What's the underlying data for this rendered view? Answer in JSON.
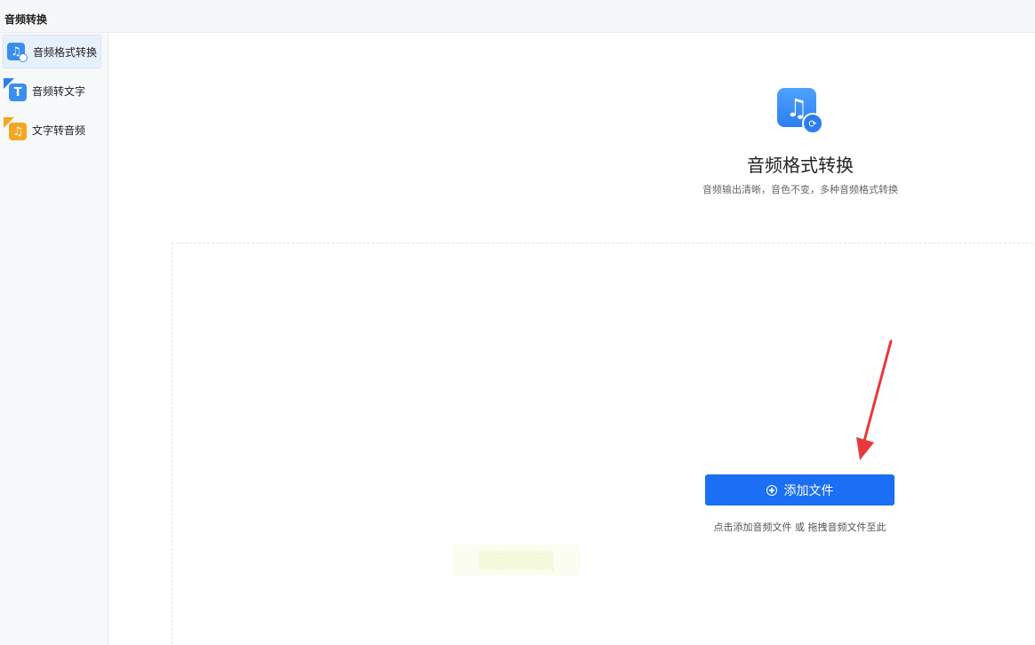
{
  "window": {
    "title": "音频转换"
  },
  "sidebar": {
    "items": [
      {
        "label": "音频格式转换",
        "icon": "audio-convert-icon",
        "active": true
      },
      {
        "label": "音频转文字",
        "icon": "audio-to-text-icon",
        "active": false
      },
      {
        "label": "文字转音频",
        "icon": "text-to-audio-icon",
        "active": false
      }
    ]
  },
  "main": {
    "title": "音频格式转换",
    "subtitle": "音频输出清晰，音色不变，多种音频格式转换",
    "add_button_label": "添加文件",
    "hint": "点击添加音频文件 或 拖拽音频文件至此"
  },
  "colors": {
    "primary": "#1a6ff5",
    "accent_orange": "#f5a623",
    "annotation_arrow": "#e8383d"
  }
}
